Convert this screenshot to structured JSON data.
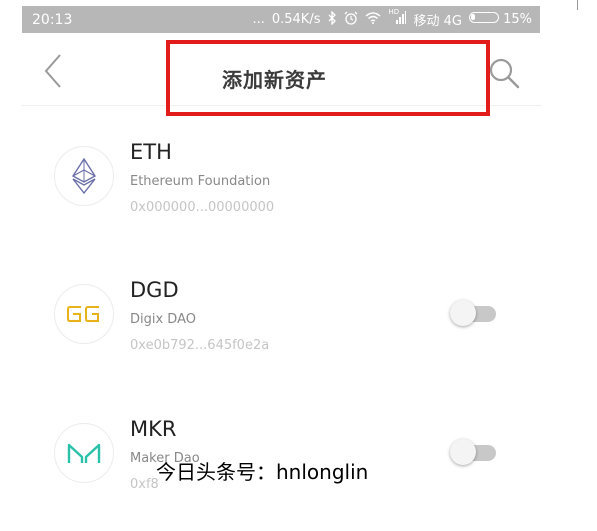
{
  "status_bar": {
    "time": "20:13",
    "dots": "...",
    "net_speed": "0.54K/s",
    "signal_label": "HD",
    "carrier": "移动 4G",
    "battery": "15%",
    "battery_level": 0.15
  },
  "nav": {
    "title": "添加新资产"
  },
  "tokens": [
    {
      "symbol": "ETH",
      "name": "Ethereum Foundation",
      "address": "0x000000...00000000",
      "logo_icon": "ethereum-icon",
      "logo_color": "#6b6fa8"
    },
    {
      "symbol": "DGD",
      "name": "Digix DAO",
      "address": "0xe0b792...645f0e2a",
      "logo_icon": "digix-icon",
      "logo_color": "#e8b31a",
      "toggle_on": false
    },
    {
      "symbol": "MKR",
      "name": "Maker Dao",
      "address": "0xf8",
      "logo_icon": "maker-icon",
      "logo_color": "#2ac1a9",
      "toggle_on": false
    }
  ],
  "watermark": "今日头条号：hnlonglin",
  "colors": {
    "highlight_border": "#e21b1b",
    "status_bar_bg": "#b7b7b7"
  }
}
